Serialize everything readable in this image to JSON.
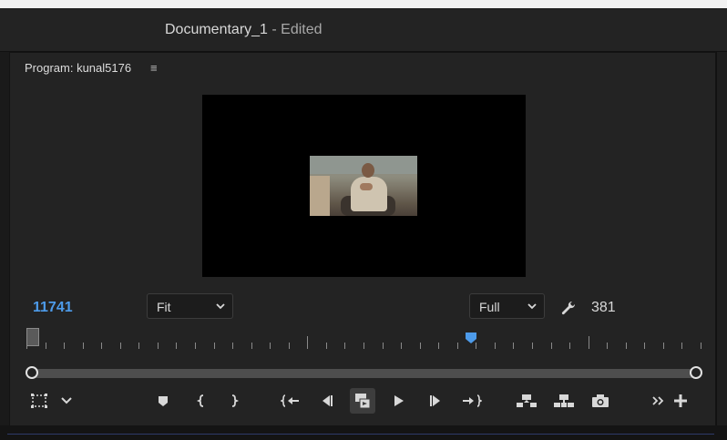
{
  "window": {
    "title": "Documentary_1",
    "title_suffix": "- Edited"
  },
  "panel": {
    "title": "Program: kunal5176",
    "menu_icon": "hamburger-menu-icon"
  },
  "monitor": {
    "timecode": "11741",
    "zoom_select": {
      "value": "Fit"
    },
    "resolution_select": {
      "value": "Full"
    },
    "frame_count": "381",
    "playhead_fraction": 0.66
  },
  "transport": {
    "icons": [
      "safe-margins-icon",
      "chevron-down-icon",
      "add-marker-icon",
      "mark-in-icon",
      "mark-out-icon",
      "go-to-in-icon",
      "step-back-icon",
      "play-icon-active-toggle",
      "play-icon",
      "step-forward-icon",
      "go-to-out-icon",
      "lift-icon",
      "extract-icon",
      "export-frame-icon",
      "more-icon",
      "add-button-icon"
    ]
  },
  "colors": {
    "timecode": "#4d9bea",
    "playhead": "#4d9bea",
    "panel_bg": "#232323"
  }
}
